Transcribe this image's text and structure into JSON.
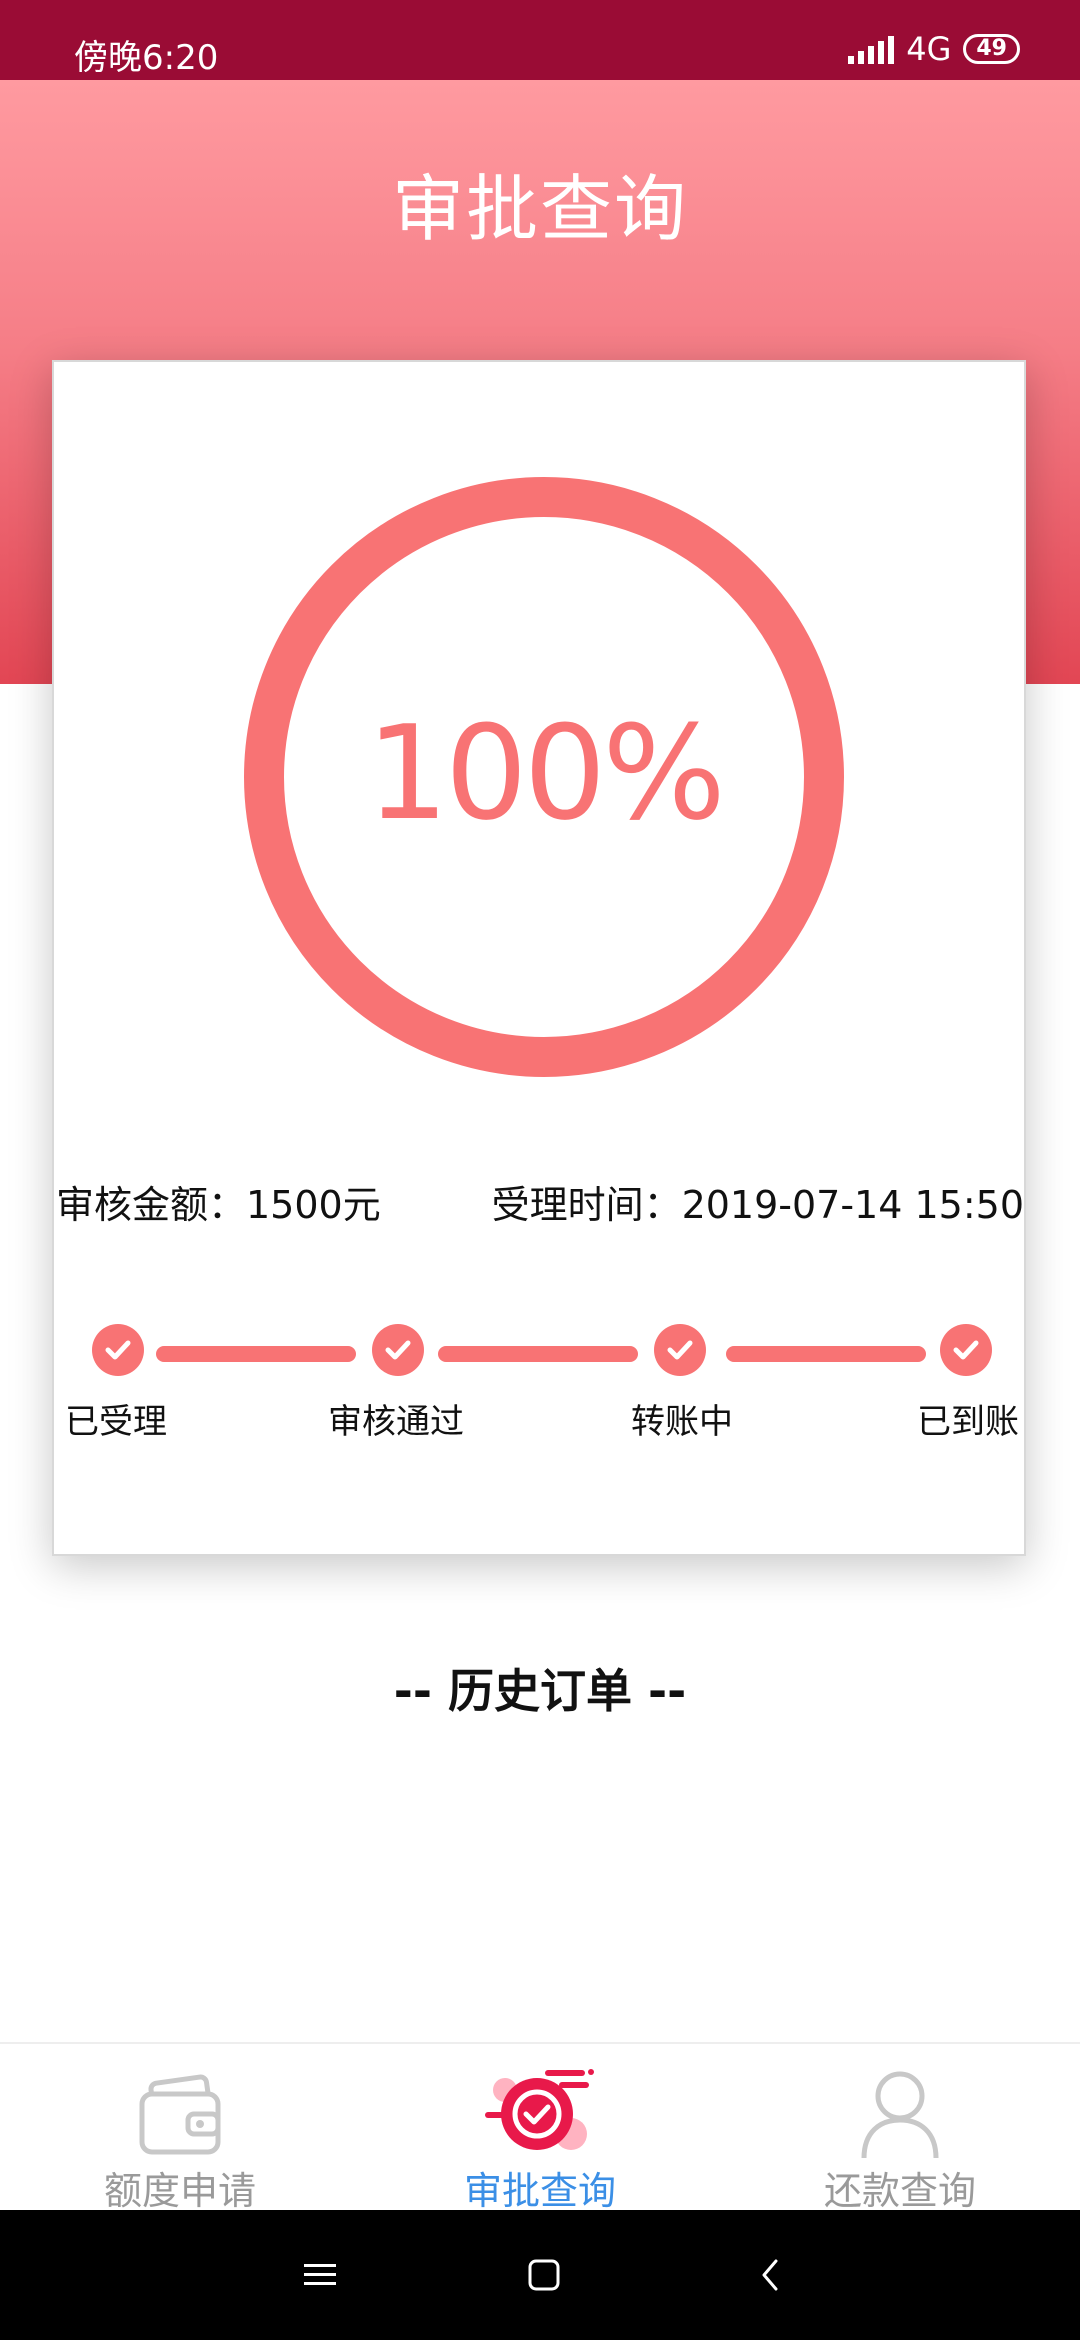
{
  "status_bar": {
    "time": "傍晚6:20",
    "network": "4G",
    "battery": "49"
  },
  "header": {
    "title": "审批查询"
  },
  "progress": {
    "percent_text": "100%",
    "value": 1.0
  },
  "details": {
    "amount": "审核金额：1500元",
    "time": "受理时间：2019-07-14 15:50"
  },
  "steps": [
    {
      "label": "已受理"
    },
    {
      "label": "审核通过"
    },
    {
      "label": "转账中"
    },
    {
      "label": "已到账"
    }
  ],
  "history": {
    "title": "-- 历史订单 --"
  },
  "tabs": [
    {
      "label": "额度申请",
      "icon": "wallet-icon",
      "active": false
    },
    {
      "label": "审批查询",
      "icon": "approval-check-icon",
      "active": true
    },
    {
      "label": "还款查询",
      "icon": "user-icon",
      "active": false
    }
  ],
  "colors": {
    "accent": "#f87374",
    "status_bar": "#9a0c35",
    "active_tab": "#3b8fe6",
    "inactive_tab": "#9a9a9a"
  }
}
